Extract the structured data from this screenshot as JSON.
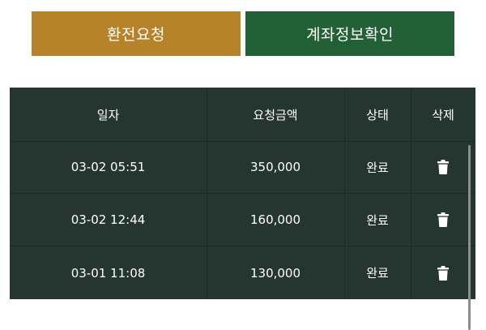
{
  "tabs": {
    "exchange_request": "환전요청",
    "account_info": "계좌정보확인"
  },
  "table": {
    "columns": {
      "date": "일자",
      "amount": "요청금액",
      "status": "상태",
      "delete": "삭제"
    },
    "rows": [
      {
        "date": "03-02 05:51",
        "amount": "350,000",
        "status": "완료",
        "delete_icon": "trash-icon"
      },
      {
        "date": "03-02 12:44",
        "amount": "160,000",
        "status": "완료",
        "delete_icon": "trash-icon"
      },
      {
        "date": "03-01 11:08",
        "amount": "130,000",
        "status": "완료",
        "delete_icon": "trash-icon"
      }
    ]
  },
  "colors": {
    "exchange_button": "#b7832a",
    "account_button": "#246036",
    "table_background": "#253530"
  }
}
